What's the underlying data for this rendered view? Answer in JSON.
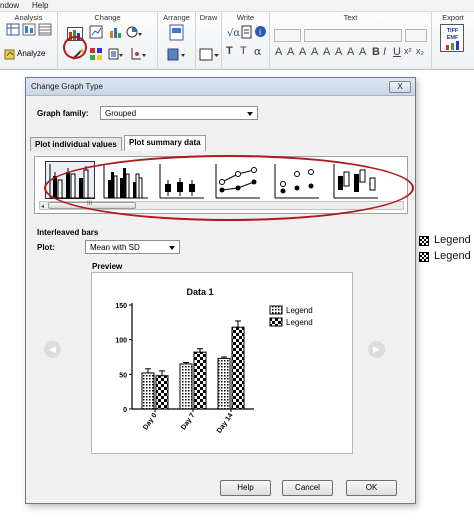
{
  "menubar": {
    "items": [
      "ndow",
      "Help"
    ]
  },
  "ribbon": {
    "groups": {
      "analysis": "Analysis",
      "change": "Change",
      "arrange": "Arrange",
      "draw": "Draw",
      "write": "Write",
      "text": "Text",
      "export": "Export"
    },
    "analyze_label": "Analyze",
    "write_glyphs": [
      "T",
      "T",
      "α"
    ],
    "text_glyphs": [
      "A",
      "A",
      "A",
      "A",
      "A",
      "A",
      "A",
      "A",
      "B",
      "I",
      "U",
      "x²",
      "x₂"
    ],
    "export_badge": "TIFF EMF"
  },
  "background_legend": [
    "Legend",
    "Legend"
  ],
  "dialog": {
    "title": "Change Graph Type",
    "close_label": "X",
    "graph_family_label": "Graph family:",
    "graph_family_value": "Grouped",
    "tabs": [
      "Plot individual values",
      "Plot summary data"
    ],
    "active_tab": 1,
    "scroll_grip": "III",
    "section_title": "Interleaved bars",
    "plot_label": "Plot:",
    "plot_value": "Mean with SD",
    "preview_label": "Preview",
    "buttons": {
      "help": "Help",
      "cancel": "Cancel",
      "ok": "OK"
    },
    "nav": {
      "prev": "◀",
      "next": "▶"
    }
  },
  "chart_data": {
    "type": "bar",
    "title": "Data 1",
    "categories": [
      "Day 0",
      "Day 7",
      "Day 14"
    ],
    "series": [
      {
        "name": "Legend",
        "values": [
          52,
          65,
          73
        ],
        "errors": [
          6,
          2,
          2
        ],
        "pattern": "dots"
      },
      {
        "name": "Legend",
        "values": [
          48,
          82,
          118
        ],
        "errors": [
          7,
          5,
          9
        ],
        "pattern": "checker"
      }
    ],
    "ylim": [
      0,
      150
    ],
    "yticks": [
      0,
      50,
      100,
      150
    ],
    "legend_position": "top-right"
  }
}
